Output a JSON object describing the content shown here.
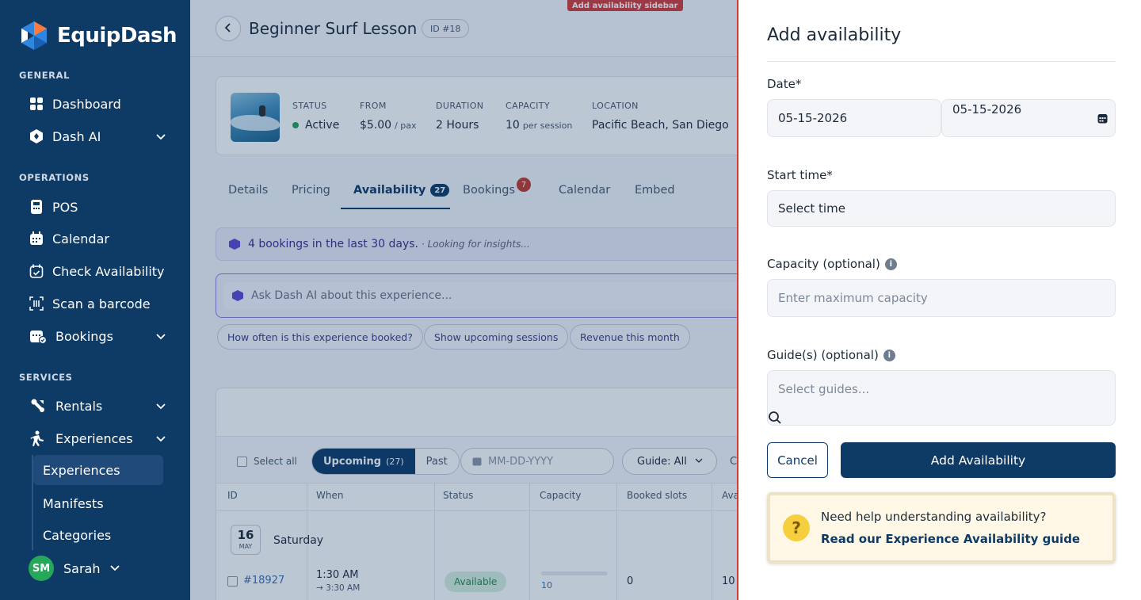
{
  "brand": {
    "name": "EquipDash",
    "accent": "#0e3a66"
  },
  "sidebar": {
    "sections": [
      {
        "label": "GENERAL"
      },
      {
        "label": "OPERATIONS"
      },
      {
        "label": "SERVICES"
      }
    ],
    "items": [
      {
        "label": "Dashboard",
        "icon": "grid-icon"
      },
      {
        "label": "Dash AI",
        "icon": "hexagon-icon",
        "expandable": true
      },
      {
        "label": "POS",
        "icon": "pos-terminal-icon"
      },
      {
        "label": "Calendar",
        "icon": "calendar-icon"
      },
      {
        "label": "Check Availability",
        "icon": "calendar-check-icon"
      },
      {
        "label": "Scan a barcode",
        "icon": "barcode-icon"
      },
      {
        "label": "Bookings",
        "icon": "bookings-icon",
        "expandable": true
      },
      {
        "label": "Rentals",
        "icon": "rentals-icon",
        "expandable": true
      },
      {
        "label": "Experiences",
        "icon": "experiences-icon",
        "expandable": true
      }
    ],
    "sub_items": [
      {
        "label": "Experiences",
        "active": true
      },
      {
        "label": "Manifests"
      },
      {
        "label": "Categories"
      }
    ],
    "user": {
      "initials": "SM",
      "name": "Sarah"
    }
  },
  "header": {
    "title": "Beginner Surf Lesson",
    "id_badge": "ID #18",
    "annotation": "Add availability sidebar"
  },
  "summary": {
    "status_label": "STATUS",
    "status_value": "Active",
    "from_label": "FROM",
    "from_value": "$5.00",
    "from_unit": "/ pax",
    "duration_label": "DURATION",
    "duration_value": "2 Hours",
    "capacity_label": "CAPACITY",
    "capacity_value": "10",
    "capacity_unit": "per session",
    "location_label": "LOCATION",
    "location_value": "Pacific Beach, San Diego"
  },
  "tabs": [
    {
      "label": "Details"
    },
    {
      "label": "Pricing"
    },
    {
      "label": "Availability",
      "count": "27",
      "active": true
    },
    {
      "label": "Bookings",
      "badge": "7"
    },
    {
      "label": "Calendar"
    },
    {
      "label": "Embed"
    }
  ],
  "insight": {
    "text": "4 bookings in the last 30 days.",
    "sub": "· Looking for insights..."
  },
  "ask_ai": {
    "placeholder": "Ask Dash AI about this experience..."
  },
  "chips": [
    "How often is this experience booked?",
    "Show upcoming sessions",
    "Revenue this month"
  ],
  "table": {
    "select_all": "Select all",
    "upcoming_label": "Upcoming",
    "upcoming_count": "(27)",
    "past_label": "Past",
    "date_placeholder": "MM-DD-YYYY",
    "guide_filter": "Guide: All",
    "truncated": "Cl",
    "columns": [
      "ID",
      "When",
      "Status",
      "Capacity",
      "Booked slots",
      "Avai"
    ],
    "group": {
      "day": "16",
      "month": "MAY",
      "weekday": "Saturday"
    },
    "rows": [
      {
        "id": "#18927",
        "start": "1:30 AM",
        "end": "→ 3:30 AM",
        "status": "Available",
        "capacity": "10",
        "booked": "0",
        "available": "10"
      }
    ]
  },
  "drawer": {
    "title": "Add availability",
    "date_label": "Date*",
    "date_start": "05-15-2026",
    "date_end": "05-15-2026",
    "start_time_label": "Start time*",
    "start_time_value": "Select time",
    "capacity_label": "Capacity (optional)",
    "capacity_placeholder": "Enter maximum capacity",
    "guides_label": "Guide(s) (optional)",
    "guides_placeholder": "Select guides...",
    "cancel_label": "Cancel",
    "submit_label": "Add Availability",
    "help_question": "Need help understanding availability?",
    "help_link": "Read our Experience Availability guide"
  }
}
